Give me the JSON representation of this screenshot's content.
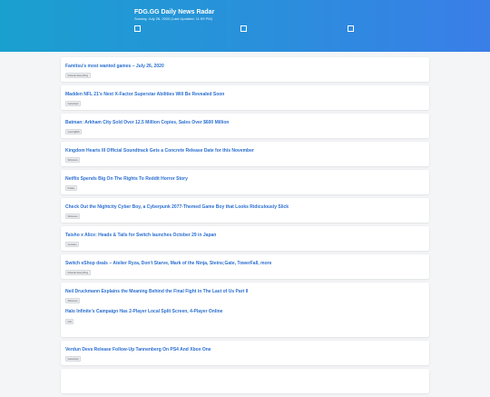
{
  "header": {
    "title": "FDG.GG Daily News Radar",
    "subtitle": "Sunday, July 26, 2020 (Last Updated: 11:59 PM)"
  },
  "feed": [
    {
      "items": [
        {
          "headline": "Famitsu's most wanted games – July 26, 2020",
          "tag": "Nintendo Everything"
        }
      ]
    },
    {
      "items": [
        {
          "headline": "Madden NFL 21's Next X-Factor Superstar Abilities Will Be Revealed Soon",
          "tag": "GameSpot"
        }
      ]
    },
    {
      "items": [
        {
          "headline": "Batman: Arkham City Sold Over 12.5 Million Copies, Sales Over $600 Million",
          "tag": "GamingBolt"
        }
      ]
    },
    {
      "items": [
        {
          "headline": "Kingdom Hearts III Official Soundtrack Gets a Concrete Release Date for this November",
          "tag": "Siliconera"
        }
      ]
    },
    {
      "items": [
        {
          "headline": "Netflix Spends Big On The Rights To Reddit Horror Story",
          "tag": "Kotaku"
        }
      ]
    },
    {
      "items": [
        {
          "headline": "Check Out the Nightcity Cyber Boy, a Cyberpunk 2077-Themed Game Boy that Looks Ridiculously Slick",
          "tag": "Siliconera"
        }
      ]
    },
    {
      "items": [
        {
          "headline": "Taisho x Alice: Heads & Tails for Switch launches October 29 in Japan",
          "tag": "Gematsu"
        }
      ]
    },
    {
      "items": [
        {
          "headline": "Switch eShop deals – Atelier Ryza, Don't Starve, Mark of the Ninja, Steins;Gate, TowerFall, more",
          "tag": "Nintendo Everything"
        }
      ]
    },
    {
      "items": [
        {
          "headline": "Neil Druckmann Explains the Meaning Behind the Final Fight in The Last of Us Part II",
          "tag": "Siliconera"
        },
        {
          "headline": "Halo Infinite's Campaign Has 2-Player Local Split Screen, 4-Player Online",
          "tag": "IGN"
        }
      ]
    },
    {
      "items": [
        {
          "headline": "Verdun Devs Release Follow-Up Tannenberg On PS4 And Xbox One",
          "tag": "GameSpot"
        }
      ]
    }
  ]
}
